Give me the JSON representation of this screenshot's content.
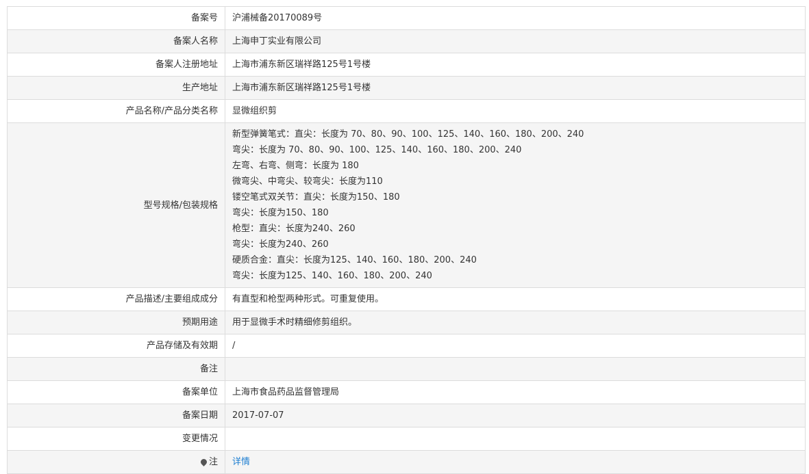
{
  "rows": [
    {
      "label": "备案号",
      "value": "沪浦械备20170089号"
    },
    {
      "label": "备案人名称",
      "value": "上海申丁实业有限公司"
    },
    {
      "label": "备案人注册地址",
      "value": "上海市浦东新区瑞祥路125号1号楼"
    },
    {
      "label": "生产地址",
      "value": "上海市浦东新区瑞祥路125号1号楼"
    },
    {
      "label": "产品名称/产品分类名称",
      "value": "显微组织剪"
    }
  ],
  "spec": {
    "label": "型号规格/包装规格",
    "lines": [
      "新型弹簧笔式：直尖：长度为 70、80、90、100、125、140、160、180、200、240",
      "弯尖：长度为 70、80、90、100、125、140、160、180、200、240",
      "左弯、右弯、侧弯：长度为 180",
      "微弯尖、中弯尖、较弯尖：长度为110",
      "镂空笔式双关节：直尖：长度为150、180",
      "弯尖：长度为150、180",
      "枪型：直尖：长度为240、260",
      "弯尖：长度为240、260",
      "硬质合金：直尖：长度为125、140、160、180、200、240",
      "弯尖：长度为125、140、160、180、200、240"
    ]
  },
  "rows2": [
    {
      "label": "产品描述/主要组成成分",
      "value": "有直型和枪型两种形式。可重复使用。"
    },
    {
      "label": "预期用途",
      "value": "用于显微手术时精细修剪组织。"
    },
    {
      "label": "产品存储及有效期",
      "value": "/"
    },
    {
      "label": "备注",
      "value": ""
    },
    {
      "label": "备案单位",
      "value": "上海市食品药品监督管理局"
    },
    {
      "label": "备案日期",
      "value": "2017-07-07"
    },
    {
      "label": "变更情况",
      "value": ""
    }
  ],
  "note": {
    "icon": "pin-icon",
    "label": "注",
    "link": "详情"
  },
  "colors": {
    "link": "#1e7fd1",
    "alt_row": "#f5f5f5",
    "border": "#dcdcdc"
  }
}
